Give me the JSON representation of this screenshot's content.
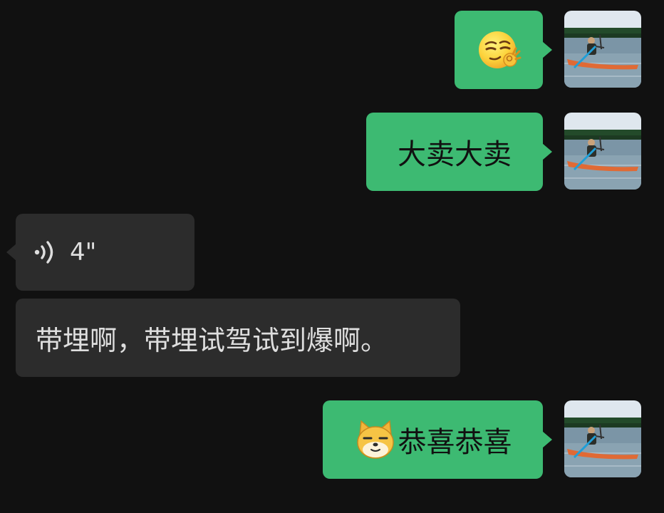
{
  "colors": {
    "background": "#111111",
    "outgoing_bubble": "#3dba72",
    "incoming_bubble": "#2c2c2c"
  },
  "messages": [
    {
      "direction": "outgoing",
      "type": "emoji",
      "emoji": "smirk-ok-emoji"
    },
    {
      "direction": "outgoing",
      "type": "text",
      "text": "大卖大卖"
    },
    {
      "direction": "incoming",
      "type": "voice",
      "duration": "4\""
    },
    {
      "direction": "incoming",
      "type": "text",
      "text": "带埋啊，带埋试驾试到爆啊。"
    },
    {
      "direction": "outgoing",
      "type": "text",
      "sticker": "doge-face-sticker",
      "text": "恭喜恭喜"
    }
  ]
}
